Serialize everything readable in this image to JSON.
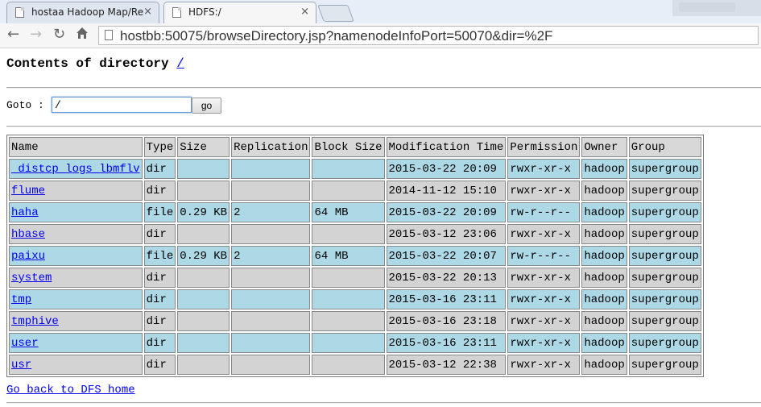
{
  "browser": {
    "tabs": [
      {
        "title": "hostaa Hadoop Map/Re",
        "active": false
      },
      {
        "title": "HDFS:/",
        "active": true
      }
    ],
    "close_glyph": "×",
    "url": "hostbb:50075/browseDirectory.jsp?namenodeInfoPort=50070&dir=%2F"
  },
  "page": {
    "heading_prefix": "Contents of directory",
    "heading_link": "/",
    "goto_label": "Goto :",
    "goto_value": "/",
    "go_button": "go",
    "back_link": "Go back to DFS home"
  },
  "listing": {
    "columns": [
      "Name",
      "Type",
      "Size",
      "Replication",
      "Block Size",
      "Modification Time",
      "Permission",
      "Owner",
      "Group"
    ],
    "rows": [
      [
        "_distcp_logs_lbmflv",
        "dir",
        "",
        "",
        "",
        "2015-03-22 20:09",
        "rwxr-xr-x",
        "hadoop",
        "supergroup"
      ],
      [
        "flume",
        "dir",
        "",
        "",
        "",
        "2014-11-12 15:10",
        "rwxr-xr-x",
        "hadoop",
        "supergroup"
      ],
      [
        "haha",
        "file",
        "0.29 KB",
        "2",
        "64 MB",
        "2015-03-22 20:09",
        "rw-r--r--",
        "hadoop",
        "supergroup"
      ],
      [
        "hbase",
        "dir",
        "",
        "",
        "",
        "2015-03-12 23:06",
        "rwxr-xr-x",
        "hadoop",
        "supergroup"
      ],
      [
        "paixu",
        "file",
        "0.29 KB",
        "2",
        "64 MB",
        "2015-03-22 20:07",
        "rw-r--r--",
        "hadoop",
        "supergroup"
      ],
      [
        "system",
        "dir",
        "",
        "",
        "",
        "2015-03-22 20:13",
        "rwxr-xr-x",
        "hadoop",
        "supergroup"
      ],
      [
        "tmp",
        "dir",
        "",
        "",
        "",
        "2015-03-16 23:11",
        "rwxr-xr-x",
        "hadoop",
        "supergroup"
      ],
      [
        "tmphive",
        "dir",
        "",
        "",
        "",
        "2015-03-16 23:18",
        "rwxr-xr-x",
        "hadoop",
        "supergroup"
      ],
      [
        "user",
        "dir",
        "",
        "",
        "",
        "2015-03-16 23:11",
        "rwxr-xr-x",
        "hadoop",
        "supergroup"
      ],
      [
        "usr",
        "dir",
        "",
        "",
        "",
        "2015-03-12 22:38",
        "rwxr-xr-x",
        "hadoop",
        "supergroup"
      ]
    ]
  },
  "icons": {
    "back": "back-arrow-icon",
    "forward": "forward-arrow-icon",
    "reload": "reload-icon",
    "home": "home-icon",
    "page": "page-icon"
  },
  "colors": {
    "row_odd": "#add8e6",
    "row_even": "#d3d3d3",
    "link": "#0000ee"
  }
}
